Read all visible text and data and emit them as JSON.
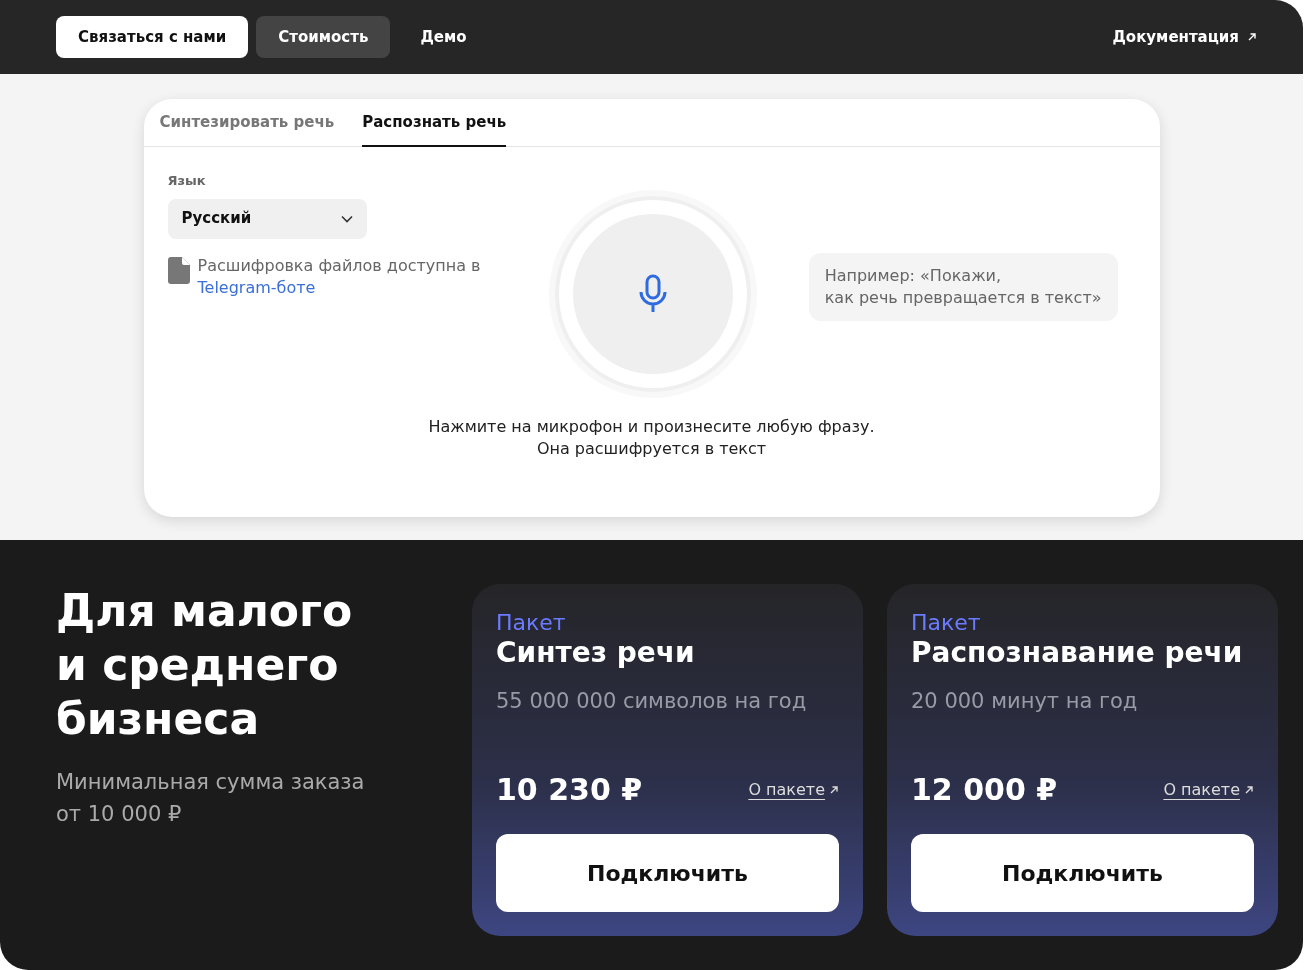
{
  "nav": {
    "items": [
      {
        "label": "Связаться с нами",
        "kind": "filled",
        "selected": false
      },
      {
        "label": "Стоимость",
        "kind": "plain",
        "selected": true
      },
      {
        "label": "Демо",
        "kind": "plain",
        "selected": false
      }
    ],
    "docs_link": "Документация"
  },
  "demo": {
    "tabs": [
      {
        "label": "Синтезировать речь",
        "selected": false
      },
      {
        "label": "Распознать речь",
        "selected": true
      }
    ],
    "language": {
      "label": "Язык",
      "value": "Русский"
    },
    "note": {
      "text": "Расшифровка файлов доступна в ",
      "link": "Telegram-боте"
    },
    "example": "Например: «Покажи,\nкак речь превращается в текст»",
    "hint": "Нажмите на микрофон и произнесите любую фразу.\nОна расшифруется в текст"
  },
  "pricing": {
    "title": "Для малого\nи среднего\nбизнеса",
    "subtitle": "Минимальная сумма заказа\nот 10 000 ₽",
    "packages": [
      {
        "eyebrow": "Пакет",
        "name": "Синтез речи",
        "volume": "55 000 000 символов на год",
        "price": "10 230 ₽",
        "link": "О пакете",
        "button": "Подключить"
      },
      {
        "eyebrow": "Пакет",
        "name": "Распознавание речи",
        "volume": "20 000 минут на год",
        "price": "12 000 ₽",
        "link": "О пакете",
        "button": "Подключить"
      }
    ]
  }
}
